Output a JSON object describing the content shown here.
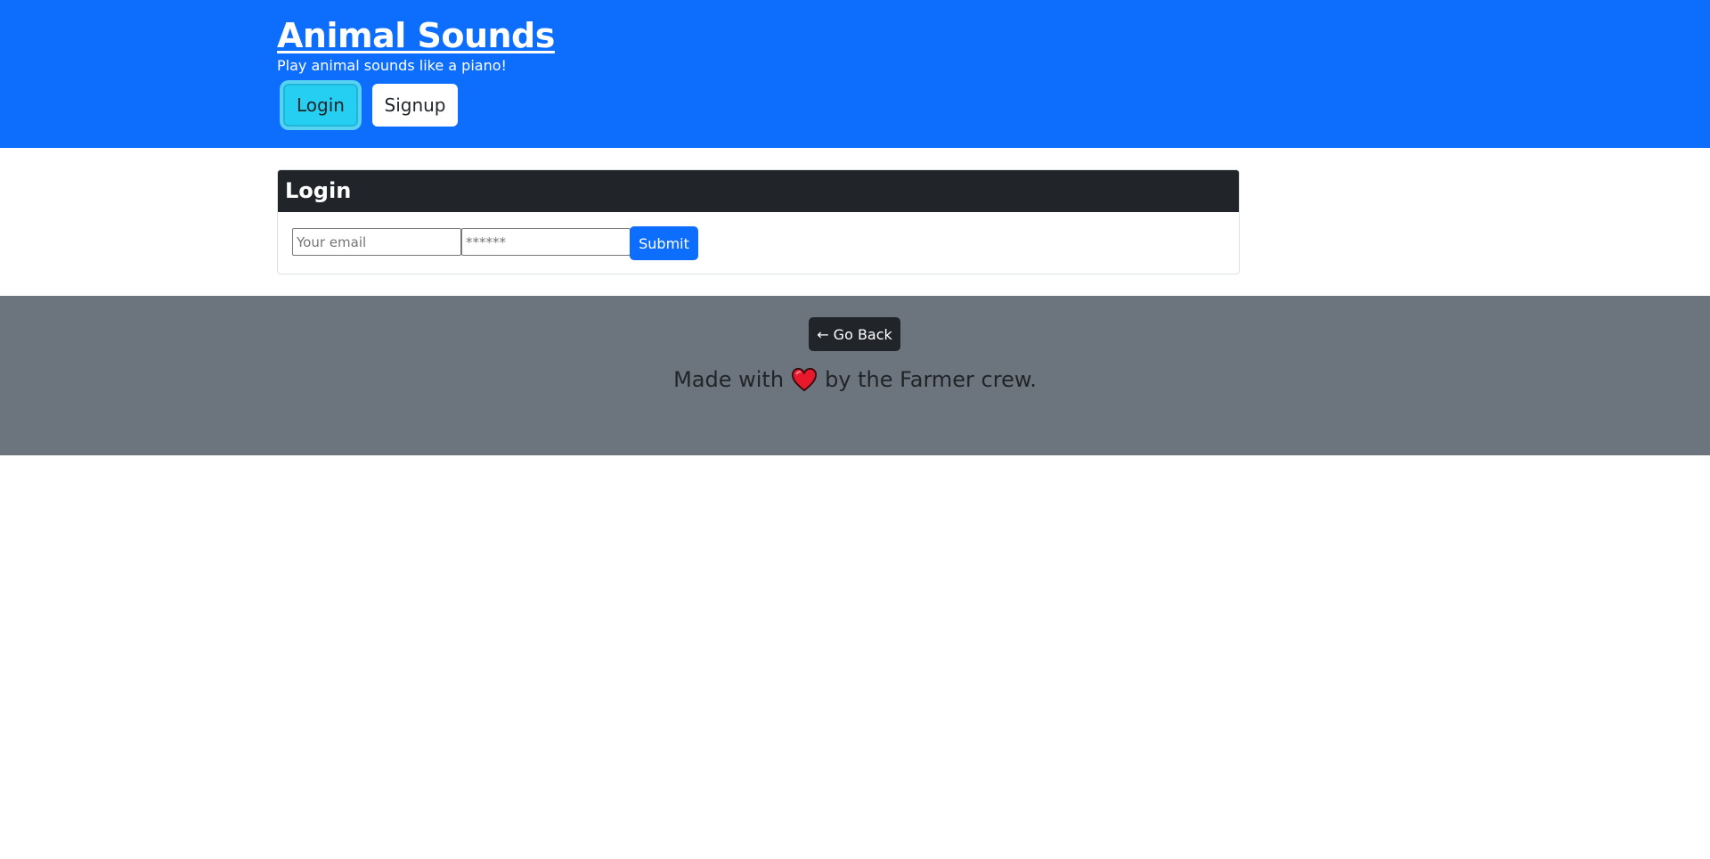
{
  "header": {
    "title": "Animal Sounds",
    "tagline": "Play animal sounds like a piano!",
    "nav": {
      "login_label": "Login",
      "signup_label": "Signup"
    }
  },
  "login_card": {
    "title": "Login",
    "email_placeholder": "Your email",
    "password_placeholder": "******",
    "submit_label": "Submit"
  },
  "footer": {
    "back_label": "← Go Back",
    "made_with_prefix": "Made with",
    "made_with_suffix": "by the Farmer crew.",
    "heart_icon": "heart-icon"
  },
  "colors": {
    "primary": "#0d6efd",
    "active_nav": "#25cff2",
    "dark": "#212529",
    "footer_bg": "#6c757d",
    "heart": "#e8192c"
  }
}
